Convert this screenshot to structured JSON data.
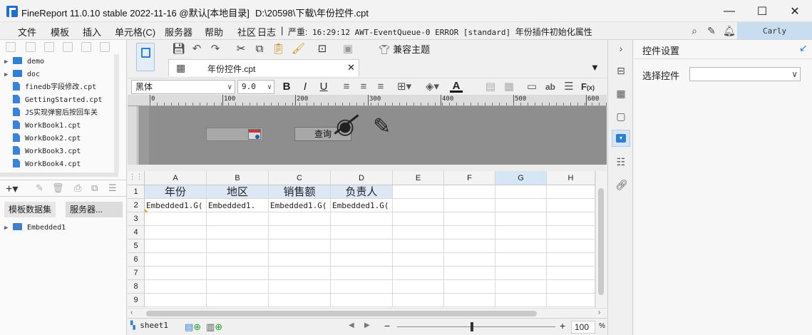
{
  "window": {
    "app_title": "FineReport 11.0.10 stable 2022-11-16 @默认[本地目录]",
    "file_path": "D:\\20598\\下载\\年份控件.cpt",
    "minimize_glyph": "—",
    "maximize_glyph": "☐",
    "close_glyph": "✕"
  },
  "menu": {
    "items": [
      "文件",
      "模板",
      "插入",
      "单元格(C)",
      "服务器",
      "帮助",
      "社区",
      "日志"
    ],
    "separator": "|",
    "log_prefix": "严重:",
    "log_text": "16:29:12 AWT-EventQueue-0 ERROR [standard]",
    "log_suffix": "年份插件初始化属性",
    "user": "Carly"
  },
  "left_panel": {
    "tree": [
      {
        "type": "folder",
        "label": "demo"
      },
      {
        "type": "folder",
        "label": "doc"
      },
      {
        "type": "file",
        "label": "finedb字段修改.cpt"
      },
      {
        "type": "file",
        "label": "GettingStarted.cpt"
      },
      {
        "type": "file",
        "label": "JS实现弹窗后按回车关"
      },
      {
        "type": "file",
        "label": "WorkBook1.cpt"
      },
      {
        "type": "file",
        "label": "WorkBook2.cpt"
      },
      {
        "type": "file",
        "label": "WorkBook3.cpt"
      },
      {
        "type": "file",
        "label": "WorkBook4.cpt"
      }
    ],
    "dataset_tabs": [
      "模板数据集",
      "服务器..."
    ],
    "datasets": [
      "Embedded1"
    ]
  },
  "toolbar": {
    "compat_theme": "兼容主题",
    "tab_label": "年份控件.cpt"
  },
  "format": {
    "font_name": "黑体",
    "font_size": "9.0"
  },
  "ruler": {
    "ticks": [
      "0",
      "100",
      "200",
      "300",
      "400",
      "500",
      "600"
    ]
  },
  "form": {
    "query_button": "查询"
  },
  "sheet": {
    "columns": [
      "A",
      "B",
      "C",
      "D",
      "E",
      "F",
      "G",
      "H"
    ],
    "rows": [
      "1",
      "2",
      "3",
      "4",
      "5",
      "6",
      "7",
      "8",
      "9"
    ],
    "row1": [
      "年份",
      "地区",
      "销售额",
      "负责人"
    ],
    "row2": [
      "Embedded1.G(",
      "Embedded1.",
      "Embedded1.G(",
      "Embedded1.G("
    ],
    "selected_column": "G"
  },
  "right_panel": {
    "title": "控件设置",
    "select_label": "选择控件",
    "select_value": ""
  },
  "bottom": {
    "sheet_tab": "sheet1",
    "zoom": "100",
    "zoom_unit": "%",
    "zoom_minus": "−",
    "zoom_plus": "+"
  },
  "colors": {
    "accent": "#2d7fd6",
    "header_cell": "#dce8f6",
    "selected_col": "#d5e6f7",
    "canvas": "#9a9a9a"
  }
}
